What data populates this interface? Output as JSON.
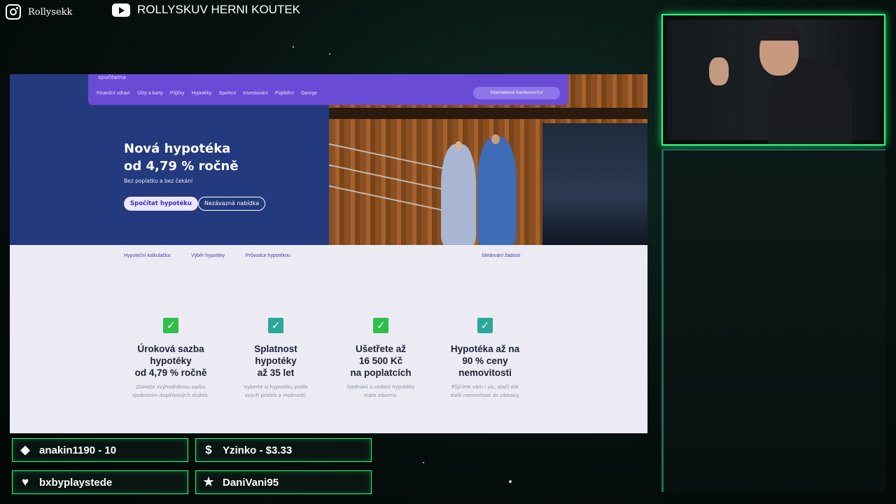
{
  "overlay": {
    "instagram": {
      "icon": "instagram-icon",
      "handle": "Rollysekk"
    },
    "youtube": {
      "icon": "youtube-icon",
      "channel": "ROLLYSKUV HERNI KOUTEK"
    }
  },
  "site": {
    "nav": {
      "items": [
        "Finanční zdraví",
        "Účty a karty",
        "Půjčky",
        "Hypotéky",
        "Spoření",
        "Investování",
        "Pojištění",
        "George"
      ],
      "ib_button": "Internetové bankovnictví"
    },
    "hero": {
      "title_line1": "Nová hypotéka",
      "title_line2": "od 4,79 % ročně",
      "subtitle": "Bez poplatku a bez čekání",
      "primary_button": "Spočítat hypotéku",
      "secondary_button": "Nezávazná nabídka"
    },
    "subnav": {
      "links": [
        "Hypoteční kalkulačka",
        "Výběr hypotéky",
        "Průvodce hypotékou"
      ],
      "tracking": "Sledování žádosti"
    },
    "features": [
      {
        "title": "Úroková sazba\nhypotéky\nod 4,79 % ročně",
        "desc": "Získejte zvýhodněnou sazbu\nsjednáním doplňkových služeb.",
        "check_color": "#2fbf4a"
      },
      {
        "title": "Splatnost\nhypotéky\naž 35 let",
        "desc": "Vyberte si hypotéku podle\nsvých potřeb a možností.",
        "check_color": "#2aa89a"
      },
      {
        "title": "Ušetřete až\n16 500 Kč\nna poplatcích",
        "desc": "Sjednání a vedení hypotéky\nmáte zdarma.",
        "check_color": "#2fbf4a"
      },
      {
        "title": "Hypotéka až na\n90 % ceny\nnemovitosti",
        "desc": "Půjčíme vám i víc, stačí dát\ndalší nemovitost do zástavy.",
        "check_color": "#2aa89a"
      }
    ]
  },
  "alerts": [
    {
      "icon": "diamond-icon",
      "glyph": "◆",
      "text": "anakin1190 - 10"
    },
    {
      "icon": "dollar-icon",
      "glyph": "$",
      "text": "Yzinko - $3.33"
    },
    {
      "icon": "heart-icon",
      "glyph": "♥",
      "text": "bxbyplaystede"
    },
    {
      "icon": "star-icon",
      "glyph": "★",
      "text": "DaniVani95"
    }
  ]
}
